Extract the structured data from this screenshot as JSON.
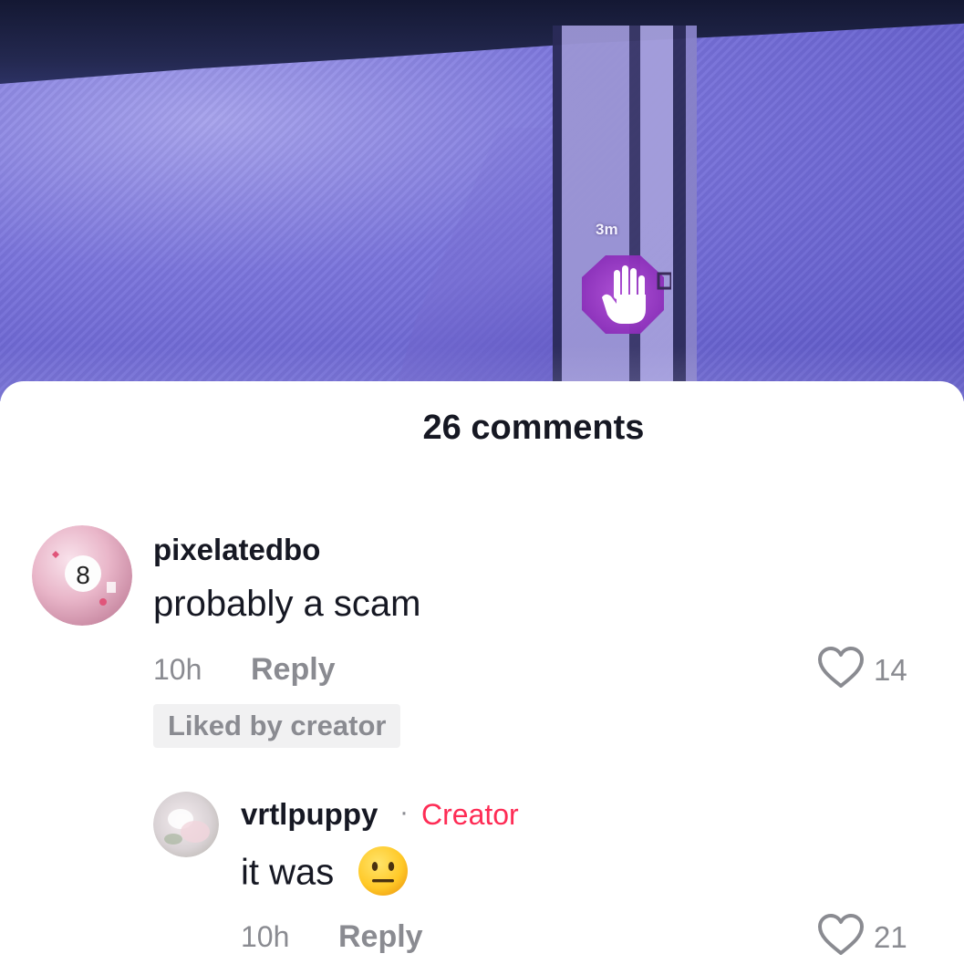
{
  "video": {
    "distance_label": "3m",
    "overlay_icon": "hand-icon"
  },
  "comments_sheet": {
    "title": "26 comments",
    "comments": [
      {
        "username": "pixelatedbo",
        "text": "probably a scam",
        "time": "10h",
        "reply_label": "Reply",
        "like_count": "14",
        "badge": "Liked by creator",
        "avatar_icon": "8-ball-avatar"
      }
    ],
    "replies": [
      {
        "username": "vrtlpuppy",
        "separator": "·",
        "tag": "Creator",
        "text": "it was",
        "emoji": "neutral-face-emoji",
        "time": "10h",
        "reply_label": "Reply",
        "like_count": "21",
        "avatar_icon": "pastel-avatar"
      }
    ]
  },
  "colors": {
    "text_primary": "#161823",
    "text_secondary": "#8a8b91",
    "creator_accent": "#fe2c55",
    "video_purple": "#6c66d4"
  }
}
